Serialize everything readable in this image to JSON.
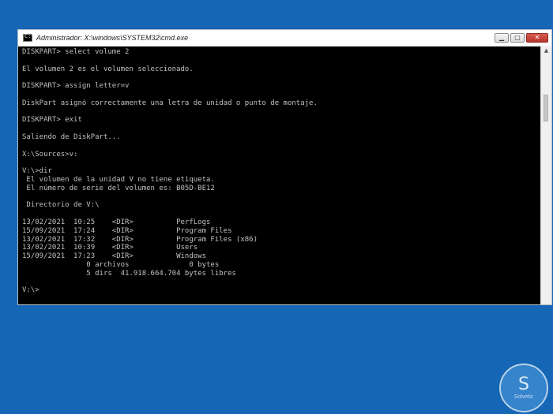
{
  "window": {
    "title": "Administrador: X:\\windows\\SYSTEM32\\cmd.exe",
    "app_icon_glyph": "C:\\",
    "controls": {
      "minimize": "▁",
      "maximize": "▢",
      "close": "✕"
    }
  },
  "console": {
    "lines": [
      "DISKPART> select volume 2",
      "",
      "El volumen 2 es el volumen seleccionado.",
      "",
      "DISKPART> assign letter=v",
      "",
      "DiskPart asignó correctamente una letra de unidad o punto de montaje.",
      "",
      "DISKPART> exit",
      "",
      "Saliendo de DiskPart...",
      "",
      "X:\\Sources>v:",
      "",
      "V:\\>dir",
      " El volumen de la unidad V no tiene etiqueta.",
      " El número de serie del volumen es: B05D-BE12",
      "",
      " Directorio de V:\\",
      "",
      "13/02/2021  10:25    <DIR>          PerfLogs",
      "15/09/2021  17:24    <DIR>          Program Files",
      "13/02/2021  17:32    <DIR>          Program Files (x86)",
      "13/02/2021  10:39    <DIR>          Users",
      "15/09/2021  17:23    <DIR>          Windows",
      "               0 archivos              0 bytes",
      "               5 dirs  41.918.664.704 bytes libres",
      "",
      "V:\\>"
    ]
  },
  "watermark": {
    "brand_mark": "S",
    "brand_text": "Solvetic"
  },
  "colors": {
    "desktop": "#1566b5",
    "console_bg": "#000000",
    "console_text": "#c0c0c0"
  }
}
